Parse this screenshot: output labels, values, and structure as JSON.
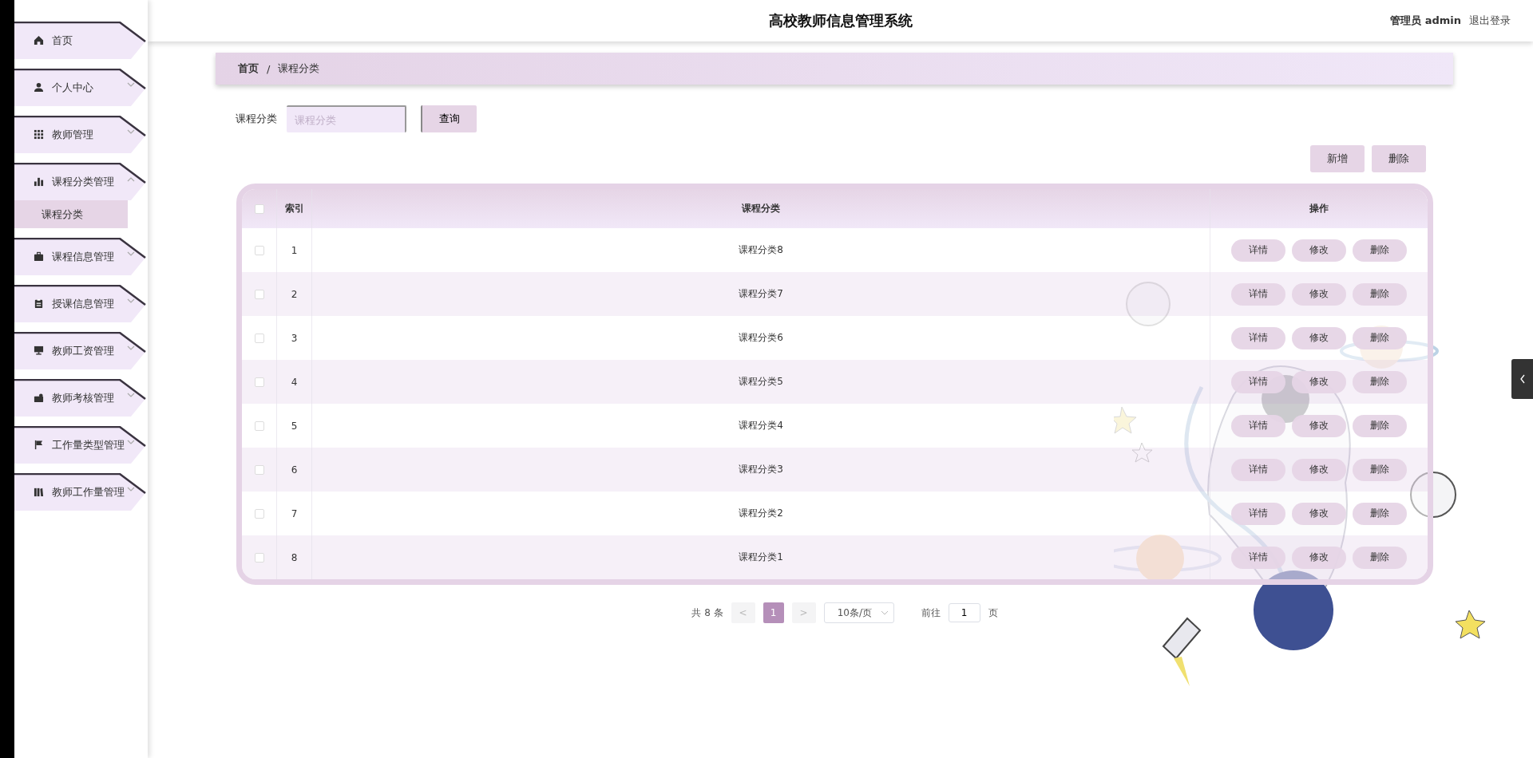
{
  "header": {
    "title": "高校教师信息管理系统",
    "user": "管理员 admin",
    "logout": "退出登录"
  },
  "sidebar": {
    "items": [
      {
        "label": "首页"
      },
      {
        "label": "个人中心",
        "expanded": false
      },
      {
        "label": "教师管理",
        "expanded": false
      },
      {
        "label": "课程分类管理",
        "expanded": true,
        "children": [
          {
            "label": "课程分类",
            "selected": true
          }
        ]
      },
      {
        "label": "课程信息管理",
        "expanded": false
      },
      {
        "label": "授课信息管理",
        "expanded": false
      },
      {
        "label": "教师工资管理",
        "expanded": false
      },
      {
        "label": "教师考核管理",
        "expanded": false
      },
      {
        "label": "工作量类型管理",
        "expanded": false
      },
      {
        "label": "教师工作量管理",
        "expanded": false
      }
    ]
  },
  "breadcrumb": {
    "separator": "/",
    "items": [
      "首页",
      "课程分类"
    ]
  },
  "search": {
    "label": "课程分类",
    "placeholder": "课程分类",
    "button": "查询"
  },
  "actions": [
    "新增",
    "删除"
  ],
  "table": {
    "header_checked": false,
    "columns": [
      "索引",
      "课程分类",
      "操作"
    ],
    "rows": [
      {
        "checked": false,
        "index": "1",
        "category": "课程分类8",
        "actions": [
          "详情",
          "修改",
          "删除"
        ]
      },
      {
        "checked": false,
        "index": "2",
        "category": "课程分类7",
        "actions": [
          "详情",
          "修改",
          "删除"
        ]
      },
      {
        "checked": false,
        "index": "3",
        "category": "课程分类6",
        "actions": [
          "详情",
          "修改",
          "删除"
        ]
      },
      {
        "checked": false,
        "index": "4",
        "category": "课程分类5",
        "actions": [
          "详情",
          "修改",
          "删除"
        ]
      },
      {
        "checked": false,
        "index": "5",
        "category": "课程分类4",
        "actions": [
          "详情",
          "修改",
          "删除"
        ]
      },
      {
        "checked": false,
        "index": "6",
        "category": "课程分类3",
        "actions": [
          "详情",
          "修改",
          "删除"
        ]
      },
      {
        "checked": false,
        "index": "7",
        "category": "课程分类2",
        "actions": [
          "详情",
          "修改",
          "删除"
        ]
      },
      {
        "checked": false,
        "index": "8",
        "category": "课程分类1",
        "actions": [
          "详情",
          "修改",
          "删除"
        ]
      }
    ]
  },
  "pagination": {
    "total": "共 8 条",
    "prev": "<",
    "pages": [
      {
        "label": "1",
        "selected": true
      }
    ],
    "next": ">",
    "page_size": "10条/页",
    "goto_label": "前往",
    "goto_value": "1",
    "goto_suffix": "页"
  }
}
